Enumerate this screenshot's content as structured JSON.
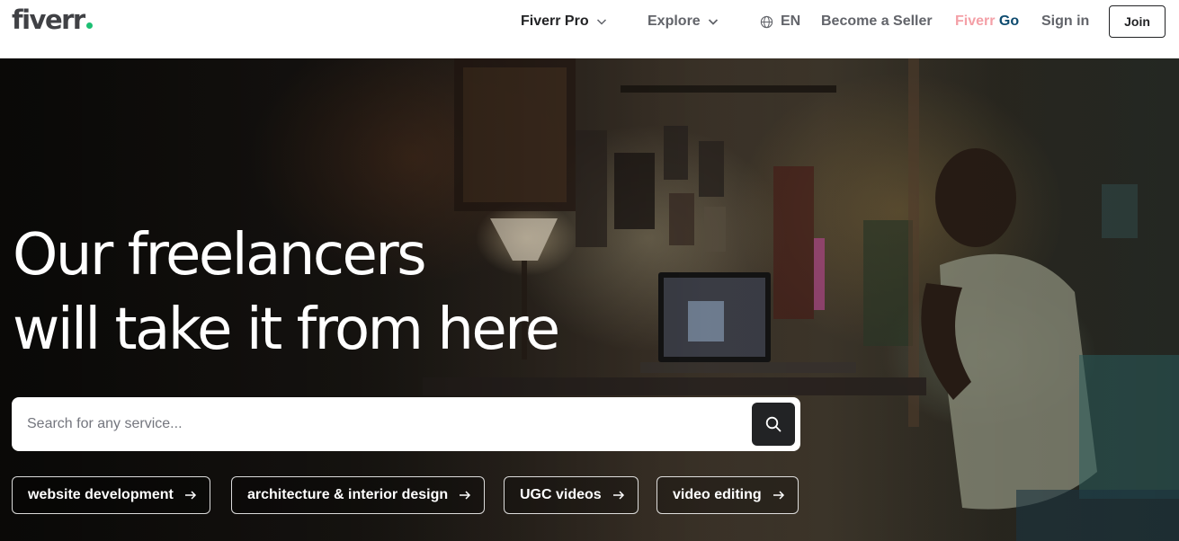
{
  "header": {
    "logo_text": "fiverr",
    "logo_dot_color": "#1dbf73",
    "nav": {
      "fiverr_pro": "Fiverr Pro",
      "explore": "Explore",
      "language": "EN",
      "become_seller": "Become a Seller",
      "fiverr_go_part1": "Fiverr",
      "fiverr_go_part2": "Go",
      "sign_in": "Sign in",
      "join": "Join"
    }
  },
  "hero": {
    "title_line1": "Our freelancers",
    "title_line2": "will take it from here",
    "search": {
      "placeholder": "Search for any service...",
      "value": ""
    },
    "chips": [
      {
        "label": "website development",
        "icon": "arrow-right-icon"
      },
      {
        "label": "architecture & interior design",
        "icon": "arrow-right-icon"
      },
      {
        "label": "UGC videos",
        "icon": "arrow-right-icon"
      },
      {
        "label": "video editing",
        "icon": "arrow-right-icon"
      }
    ]
  },
  "colors": {
    "brand_green": "#1dbf73",
    "text_dark": "#222325",
    "text_gray": "#62646a",
    "fiverr_go_pink": "#f4a0a7",
    "fiverr_go_blue": "#0e4b6f"
  }
}
